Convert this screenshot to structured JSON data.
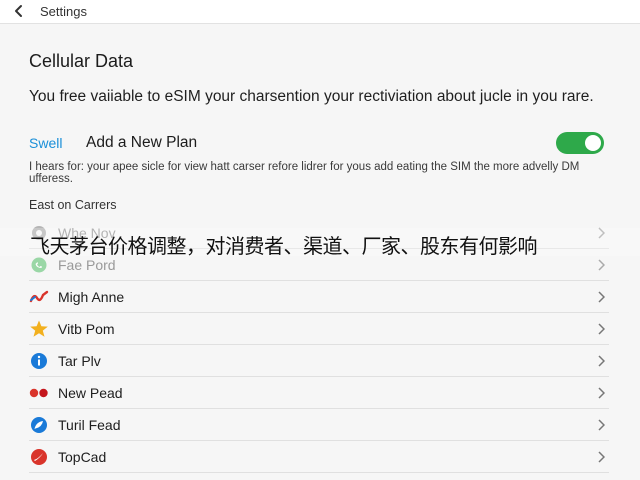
{
  "topbar": {
    "title": "Settings",
    "back_icon": "chevron-left-icon"
  },
  "page": {
    "title": "Cellular Data",
    "description": "You free vaiiable to eSIM your charsention your rectiviation about jucle in you rare."
  },
  "plan": {
    "link_label": "Swell",
    "label": "Add a New Plan",
    "toggle_on": true,
    "toggle_color": "#2ea94a"
  },
  "fine_print": "I hears for: your apee sicle for view hatt carser refore lidrer for yous add eating the SIM the more advelly DM ufferess.",
  "section_label": "East on Carrers",
  "carriers": [
    {
      "label": "Whe Nov",
      "icon": "whatsapp-icon",
      "color": "#9a9a9a"
    },
    {
      "label": "Fae Pord",
      "icon": "whatsapp-icon",
      "color": "#9ad7a6"
    },
    {
      "label": "Migh Anne",
      "icon": "squiggle-icon",
      "color": "#d9342b"
    },
    {
      "label": "Vitb Pom",
      "icon": "star-icon",
      "color": "#f2b01e"
    },
    {
      "label": "Tar Plv",
      "icon": "info-icon",
      "color": "#1a7ad8"
    },
    {
      "label": "New Pead",
      "icon": "two-dots-icon",
      "color": "#d9342b"
    },
    {
      "label": "Turil Fead",
      "icon": "leaf-icon",
      "color": "#1a7ad8"
    },
    {
      "label": "TopCad",
      "icon": "swoosh-icon",
      "color": "#d9342b"
    }
  ],
  "overlay_caption": "飞天茅台价格调整，对消费者、渠道、厂家、股东有何影响"
}
